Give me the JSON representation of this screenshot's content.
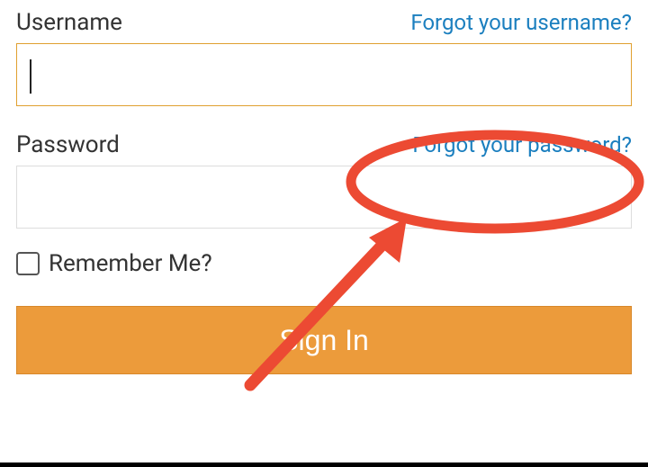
{
  "username": {
    "label": "Username",
    "forgot": "Forgot your username?",
    "value": ""
  },
  "password": {
    "label": "Password",
    "forgot": "Forgot your password?",
    "value": ""
  },
  "remember": {
    "label": "Remember Me?"
  },
  "signin": {
    "label": "Sign In"
  }
}
